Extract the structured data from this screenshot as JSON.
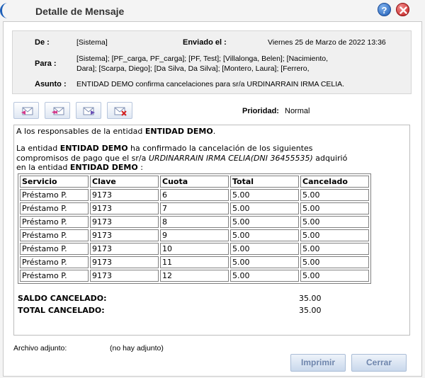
{
  "window": {
    "title": "Detalle de Mensaje",
    "help_label": "?"
  },
  "header": {
    "from_label": "De :",
    "from_value": "[Sistema]",
    "sent_label": "Enviado el :",
    "sent_value": "Viernes 25 de Marzo de 2022 13:36",
    "to_label": "Para :",
    "to_line1": "[Sistema]; [PF_carga, PF_carga]; [PF, Test]; [Villalonga, Belen]; [Nacimiento,",
    "to_line2": "Dara]; [Scarpa, Diego]; [Da Silva, Da Silva]; [Montero, Laura]; [Ferrero,",
    "subject_label": "Asunto :",
    "subject_value": "ENTIDAD DEMO confirma cancelaciones para sr/a URDINARRAIN IRMA CELIA."
  },
  "toolbar": {
    "icons": [
      "reply-icon",
      "reply-all-icon",
      "forward-icon",
      "delete-icon"
    ]
  },
  "priority": {
    "label": "Prioridad:",
    "value": "Normal"
  },
  "message": {
    "line1_pre": "A los responsables de la entidad ",
    "line1_bold": "ENTIDAD DEMO",
    "line1_post": ".",
    "line2_pre": "La entidad ",
    "line2_bold": "ENTIDAD DEMO",
    "line2_post": " ha confirmado la cancelación de los siguientes",
    "line3_pre": "compromisos de pago que el sr/a ",
    "line3_italic": "URDINARRAIN IRMA CELIA(DNI 36455535)",
    "line3_post": " adquirió",
    "line4_pre": "en la entidad ",
    "line4_bold": "ENTIDAD DEMO",
    "line4_post": " :"
  },
  "table": {
    "headers": [
      "Servicio",
      "Clave",
      "Cuota",
      "Total",
      "Cancelado"
    ],
    "rows": [
      [
        "Préstamo P.",
        "9173",
        "6",
        "5.00",
        "5.00"
      ],
      [
        "Préstamo P.",
        "9173",
        "7",
        "5.00",
        "5.00"
      ],
      [
        "Préstamo P.",
        "9173",
        "8",
        "5.00",
        "5.00"
      ],
      [
        "Préstamo P.",
        "9173",
        "9",
        "5.00",
        "5.00"
      ],
      [
        "Préstamo P.",
        "9173",
        "10",
        "5.00",
        "5.00"
      ],
      [
        "Préstamo P.",
        "9173",
        "11",
        "5.00",
        "5.00"
      ],
      [
        "Préstamo P.",
        "9173",
        "12",
        "5.00",
        "5.00"
      ]
    ]
  },
  "summary": {
    "saldo_label": "SALDO CANCELADO:",
    "saldo_value": "35.00",
    "total_label": "TOTAL CANCELADO:",
    "total_value": "35.00"
  },
  "attachment": {
    "label": "Archivo adjunto:",
    "value": "(no hay adjunto)"
  },
  "actions": {
    "print_label": "Imprimir",
    "close_label": "Cerrar"
  }
}
